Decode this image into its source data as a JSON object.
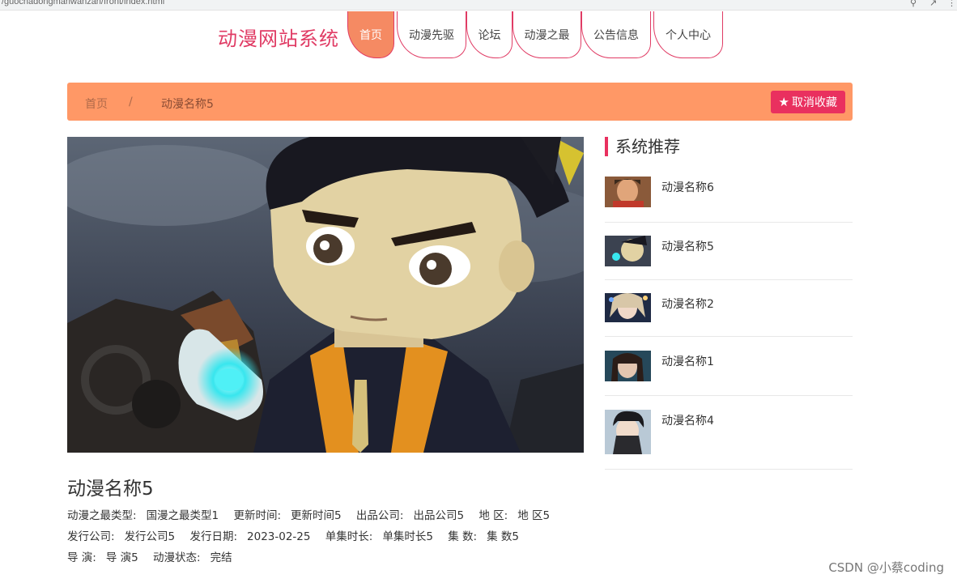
{
  "browser": {
    "url": "/guochadongmanwanzan/front/index.html"
  },
  "site": {
    "title": "动漫网站系统"
  },
  "nav": [
    {
      "label": "首页",
      "active": true
    },
    {
      "label": "动漫先驱",
      "active": false
    },
    {
      "label": "论坛",
      "active": false
    },
    {
      "label": "动漫之最",
      "active": false
    },
    {
      "label": "公告信息",
      "active": false
    },
    {
      "label": "个人中心",
      "active": false
    }
  ],
  "breadcrumb": {
    "home": "首页",
    "separator": "/",
    "current": "动漫名称5"
  },
  "favorite_button": {
    "icon": "star-icon",
    "label": "取消收藏"
  },
  "detail": {
    "title": "动漫名称5",
    "fields": [
      {
        "label": "动漫之最类型:",
        "value": "国漫之最类型1"
      },
      {
        "label": "更新时间:",
        "value": "更新时间5"
      },
      {
        "label": "出品公司:",
        "value": "出品公司5"
      },
      {
        "label": "地 区:",
        "value": "地 区5"
      },
      {
        "label": "发行公司:",
        "value": "发行公司5"
      },
      {
        "label": "发行日期:",
        "value": "2023-02-25"
      },
      {
        "label": "单集时长:",
        "value": "单集时长5"
      },
      {
        "label": "集 数:",
        "value": "集 数5"
      },
      {
        "label": "导 演:",
        "value": "导 演5"
      },
      {
        "label": "动漫状态:",
        "value": "完结"
      }
    ]
  },
  "recommend": {
    "title": "系统推荐",
    "items": [
      {
        "name": "动漫名称6"
      },
      {
        "name": "动漫名称5"
      },
      {
        "name": "动漫名称2"
      },
      {
        "name": "动漫名称1"
      },
      {
        "name": "动漫名称4"
      }
    ]
  },
  "watermark": "CSDN @小蔡coding",
  "colors": {
    "accent": "#e9305f",
    "bar": "#ff9866",
    "title": "#e03b64"
  }
}
